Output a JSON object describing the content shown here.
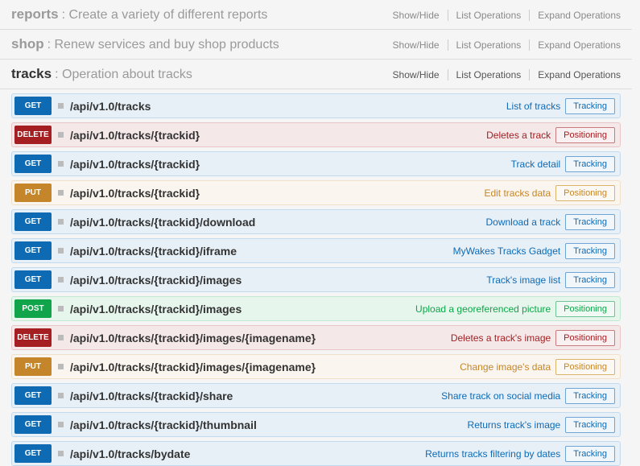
{
  "header_actions": {
    "show_hide": "Show/Hide",
    "list_ops": "List Operations",
    "expand_ops": "Expand Operations"
  },
  "sections": [
    {
      "name": "reports",
      "desc": ": Create a variety of different reports",
      "active": false
    },
    {
      "name": "shop",
      "desc": ": Renew services and buy shop products",
      "active": false
    },
    {
      "name": "tracks",
      "desc": ": Operation about tracks",
      "active": true
    }
  ],
  "operations": [
    {
      "method": "GET",
      "cls": "m-get",
      "path": "/api/v1.0/tracks",
      "summary": "List of tracks",
      "tag": "Tracking"
    },
    {
      "method": "DELETE",
      "cls": "m-delete",
      "path": "/api/v1.0/tracks/{trackid}",
      "summary": "Deletes a track",
      "tag": "Positioning"
    },
    {
      "method": "GET",
      "cls": "m-get",
      "path": "/api/v1.0/tracks/{trackid}",
      "summary": "Track detail",
      "tag": "Tracking"
    },
    {
      "method": "PUT",
      "cls": "m-put",
      "path": "/api/v1.0/tracks/{trackid}",
      "summary": "Edit tracks data",
      "tag": "Positioning"
    },
    {
      "method": "GET",
      "cls": "m-get",
      "path": "/api/v1.0/tracks/{trackid}/download",
      "summary": "Download a track",
      "tag": "Tracking"
    },
    {
      "method": "GET",
      "cls": "m-get",
      "path": "/api/v1.0/tracks/{trackid}/iframe",
      "summary": "MyWakes Tracks Gadget",
      "tag": "Tracking"
    },
    {
      "method": "GET",
      "cls": "m-get",
      "path": "/api/v1.0/tracks/{trackid}/images",
      "summary": "Track's image list",
      "tag": "Tracking"
    },
    {
      "method": "POST",
      "cls": "m-post",
      "path": "/api/v1.0/tracks/{trackid}/images",
      "summary": "Upload a georeferenced picture",
      "tag": "Positioning"
    },
    {
      "method": "DELETE",
      "cls": "m-delete",
      "path": "/api/v1.0/tracks/{trackid}/images/{imagename}",
      "summary": "Deletes a track's image",
      "tag": "Positioning"
    },
    {
      "method": "PUT",
      "cls": "m-put",
      "path": "/api/v1.0/tracks/{trackid}/images/{imagename}",
      "summary": "Change image's data",
      "tag": "Positioning"
    },
    {
      "method": "GET",
      "cls": "m-get",
      "path": "/api/v1.0/tracks/{trackid}/share",
      "summary": "Share track on social media",
      "tag": "Tracking"
    },
    {
      "method": "GET",
      "cls": "m-get",
      "path": "/api/v1.0/tracks/{trackid}/thumbnail",
      "summary": "Returns track's image",
      "tag": "Tracking"
    },
    {
      "method": "GET",
      "cls": "m-get",
      "path": "/api/v1.0/tracks/bydate",
      "summary": "Returns tracks filtering by dates",
      "tag": "Tracking"
    }
  ]
}
